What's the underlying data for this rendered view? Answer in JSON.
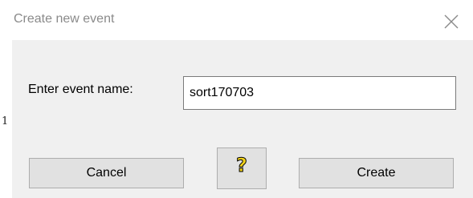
{
  "dialog": {
    "title": "Create new event",
    "close_icon": "close-icon"
  },
  "side_fragment": "1",
  "form": {
    "label": "Enter event name:",
    "event_name_value": "sort170703"
  },
  "buttons": {
    "cancel_label": "Cancel",
    "help_glyph": "?",
    "help_icon": "question-mark-icon",
    "create_label": "Create"
  }
}
